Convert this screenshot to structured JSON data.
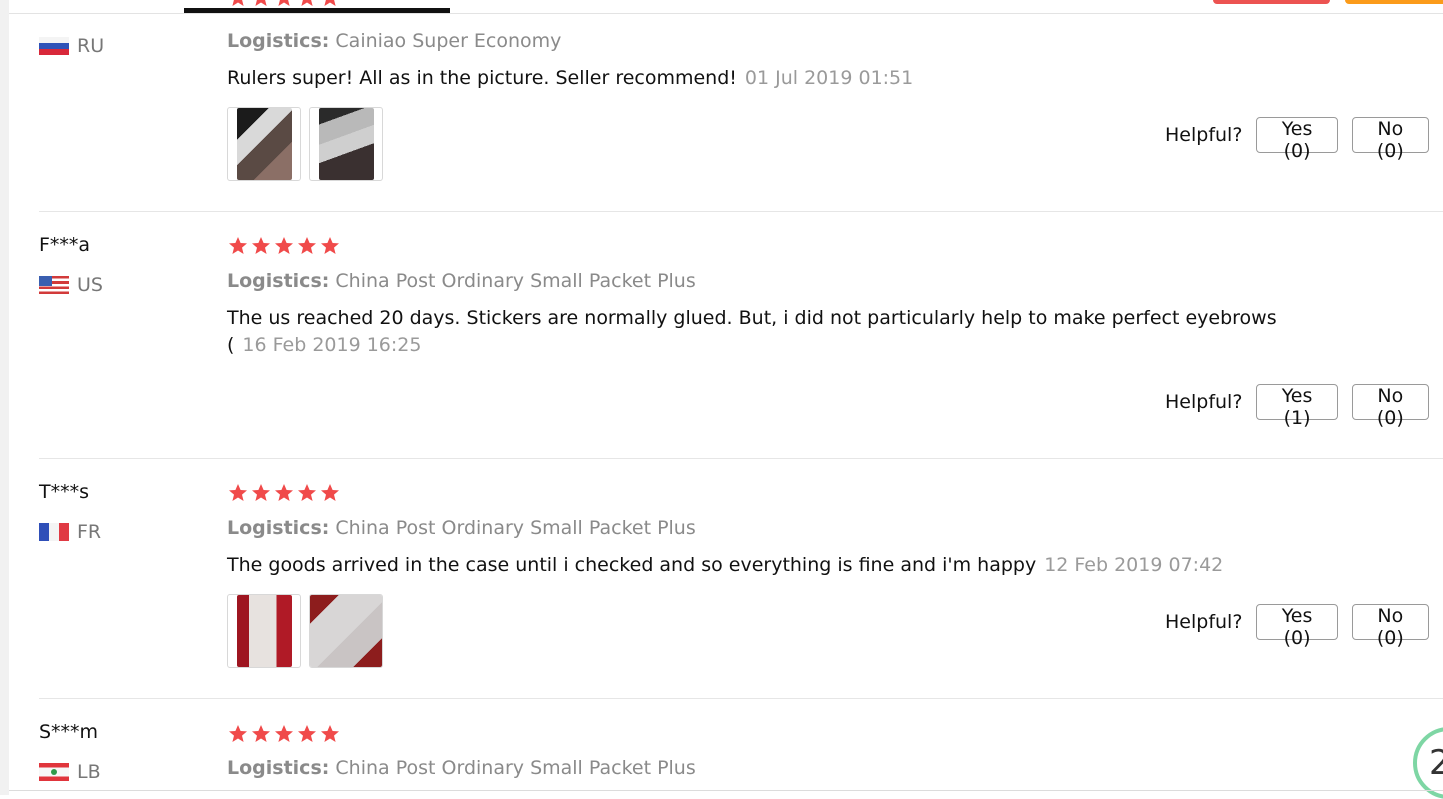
{
  "reviews": [
    {
      "user": "",
      "country": "RU",
      "logistics_label": "Logistics:",
      "logistics_value": "Cainiao Super Economy",
      "text": "Rulers super! All as in the picture. Seller recommend!",
      "date": "01 Jul 2019 01:51",
      "helpful_label": "Helpful?",
      "yes_label": "Yes (0)",
      "no_label": "No (0)",
      "rating": 5
    },
    {
      "user": "F***a",
      "country": "US",
      "logistics_label": "Logistics:",
      "logistics_value": "China Post Ordinary Small Packet Plus",
      "text": "The us reached 20 days. Stickers are normally glued. But, i did not particularly help to make perfect eyebrows (",
      "date": "16 Feb 2019 16:25",
      "helpful_label": "Helpful?",
      "yes_label": "Yes (1)",
      "no_label": "No (0)",
      "rating": 5
    },
    {
      "user": "T***s",
      "country": "FR",
      "logistics_label": "Logistics:",
      "logistics_value": "China Post Ordinary Small Packet Plus",
      "text": "The goods arrived in the case until i checked and so everything is fine and i'm happy",
      "date": "12 Feb 2019 07:42",
      "helpful_label": "Helpful?",
      "yes_label": "Yes (0)",
      "no_label": "No (0)",
      "rating": 5
    },
    {
      "user": "S***m",
      "country": "LB",
      "logistics_label": "Logistics:",
      "logistics_value": "China Post Ordinary Small Packet Plus",
      "rating": 5
    }
  ],
  "colors": {
    "star": "#f04a4a",
    "muted_text": "#8a8a8a",
    "accent_red": "#ec5351",
    "accent_orange": "#fb9b1a"
  },
  "icons": {
    "star": "star-icon",
    "flags": [
      "russia-flag-icon",
      "usa-flag-icon",
      "france-flag-icon",
      "lebanon-flag-icon"
    ]
  }
}
